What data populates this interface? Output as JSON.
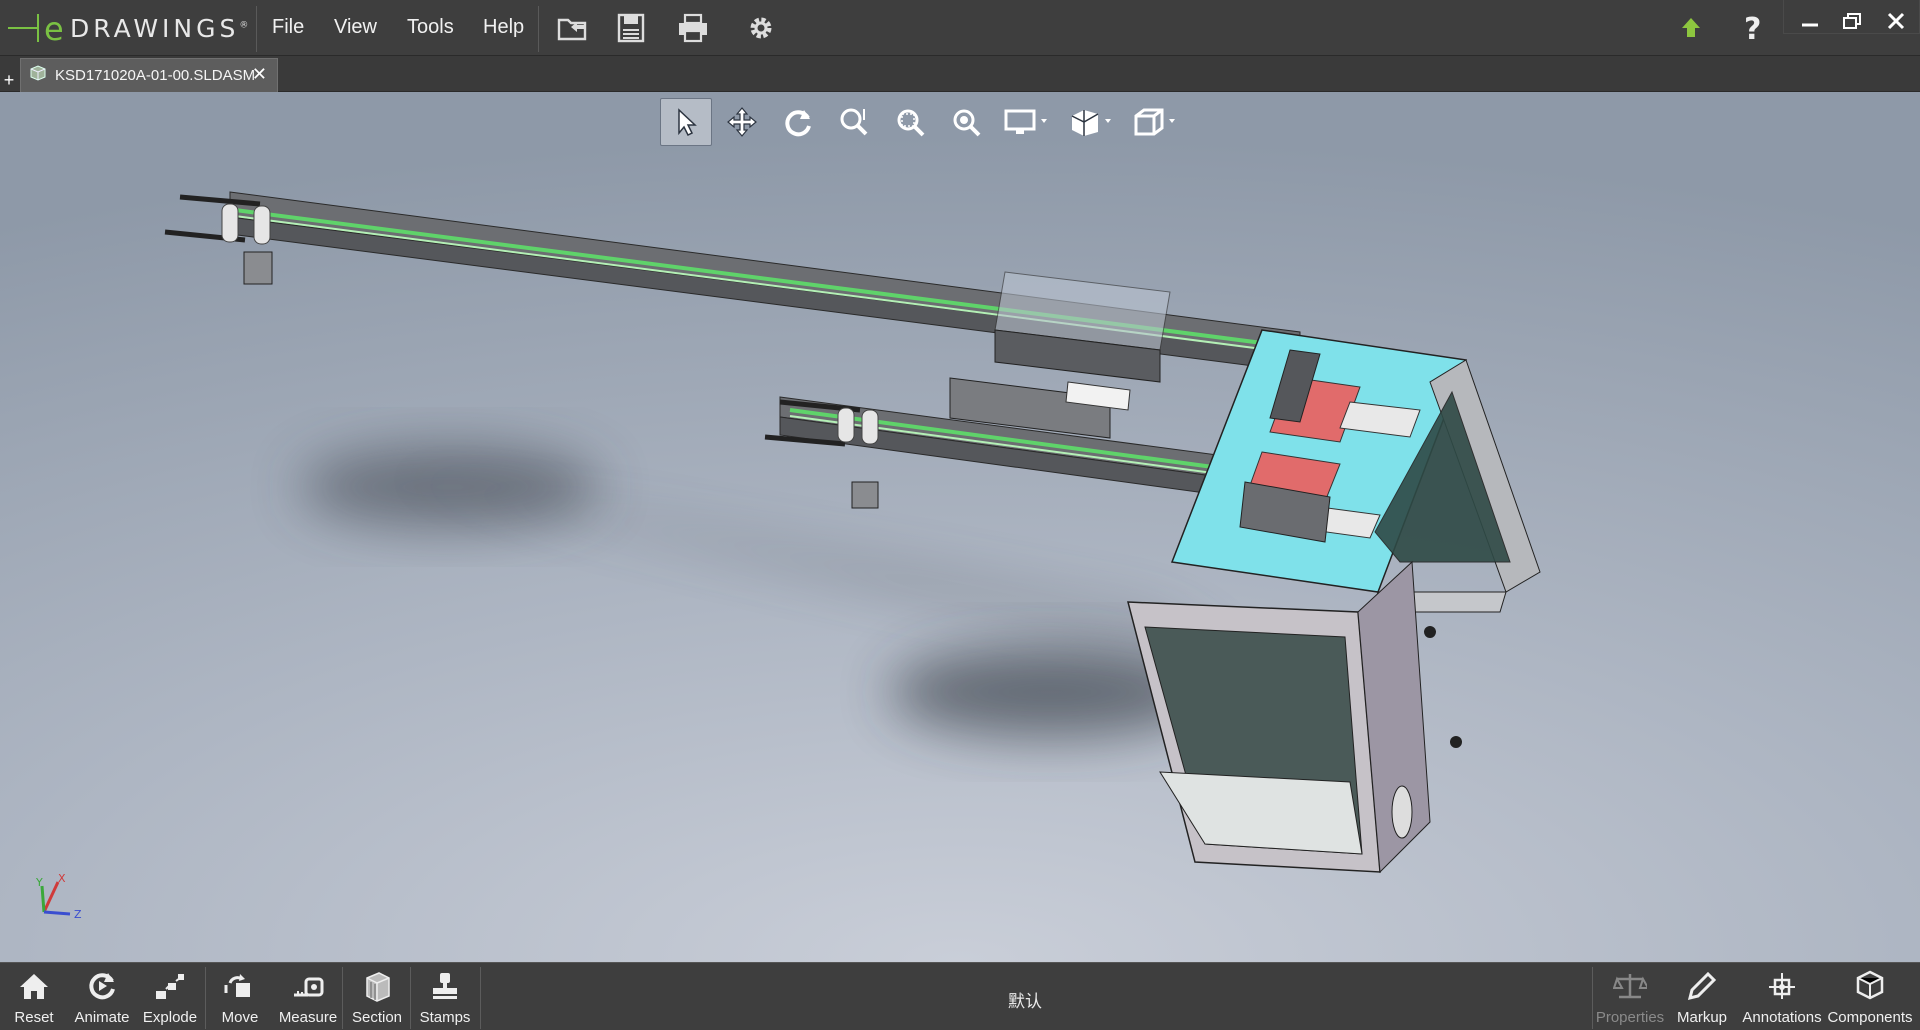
{
  "app": {
    "brand": "DRAWINGS",
    "brand_mark": "e",
    "registered": "®"
  },
  "menu": [
    "File",
    "View",
    "Tools",
    "Help"
  ],
  "toolbar": {
    "icons": [
      "open-folder-icon",
      "save-icon",
      "print-icon",
      "settings-gear-icon"
    ],
    "right_icons": [
      "upgrade-arrow-icon",
      "help-question-icon"
    ]
  },
  "window_controls": [
    "minimize-icon",
    "restore-icon",
    "close-icon"
  ],
  "tabs": {
    "new_tab": "+",
    "document": "KSD171020A-01-00.SLDASM",
    "close": "✕"
  },
  "view_toolbar": [
    "select-pointer",
    "pan",
    "rotate",
    "zoom-to-fit",
    "zoom-to-area",
    "zoom-in-out",
    "display-style",
    "view-orientation",
    "view-cube"
  ],
  "triad": {
    "x": "X",
    "y": "Y",
    "z": "Z"
  },
  "bottom": {
    "left_tools": [
      {
        "label": "Reset",
        "icon": "home-icon"
      },
      {
        "label": "Animate",
        "icon": "animate-icon"
      },
      {
        "label": "Explode",
        "icon": "explode-icon"
      },
      {
        "label": "Move",
        "icon": "move-icon"
      },
      {
        "label": "Measure",
        "icon": "measure-icon"
      },
      {
        "label": "Section",
        "icon": "section-icon"
      },
      {
        "label": "Stamps",
        "icon": "stamps-icon"
      }
    ],
    "configuration": "默认",
    "right_tools": [
      {
        "label": "Properties",
        "icon": "properties-scale-icon",
        "enabled": false
      },
      {
        "label": "Markup",
        "icon": "markup-pen-icon",
        "enabled": true
      },
      {
        "label": "Annotations",
        "icon": "annotations-icon",
        "enabled": true
      },
      {
        "label": "Components",
        "icon": "components-cube-icon",
        "enabled": true
      }
    ]
  }
}
